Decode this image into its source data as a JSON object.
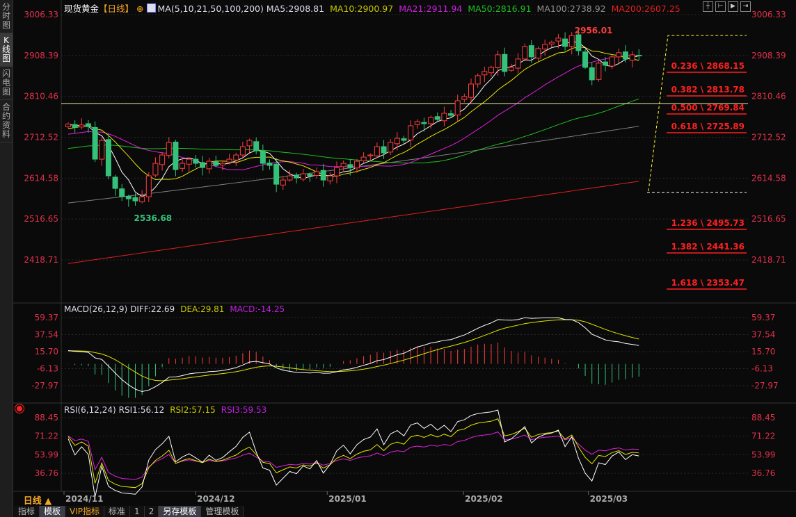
{
  "sidebar": {
    "tabs": [
      {
        "label": "分时图",
        "active": false
      },
      {
        "label": "K线图",
        "active": true
      },
      {
        "label": "闪电图",
        "active": false
      },
      {
        "label": "合约资料",
        "active": false
      }
    ]
  },
  "header": {
    "symbol": "现货黄金",
    "period": "【日线】",
    "ma_title": "MA(5,10,21,50,100,200)",
    "ma5": "MA5:2908.81",
    "ma10": "MA10:2900.97",
    "ma21": "MA21:2911.94",
    "ma50": "MA50:2816.91",
    "ma100": "MA100:2738.92",
    "ma200": "MA200:2607.25"
  },
  "toolbar_icons": [
    "crosshair-icon",
    "zoom-left-icon",
    "play-icon",
    "scroll-end-icon"
  ],
  "colors": {
    "up": "#ff3c3c",
    "down": "#34c27a",
    "ma5": "#ffffff",
    "ma10": "#e6e600",
    "ma21": "#e020e0",
    "ma50": "#20c020",
    "ma100": "#808080",
    "ma200": "#e02020",
    "axis": "#e0304a"
  },
  "price_axis": [
    "3006.33",
    "2908.39",
    "2810.46",
    "2712.52",
    "2614.58",
    "2516.65",
    "2418.71"
  ],
  "annotations": {
    "high": "2956.01",
    "low": "2536.68"
  },
  "fibonacci": [
    {
      "label": "0.236 \\ 2868.15"
    },
    {
      "label": "0.382 \\ 2813.78"
    },
    {
      "label": "0.500 \\ 2769.84"
    },
    {
      "label": "0.618 \\ 2725.89"
    },
    {
      "label": "1.236 \\ 2495.73"
    },
    {
      "label": "1.382 \\ 2441.36"
    },
    {
      "label": "1.618 \\ 2353.47"
    }
  ],
  "macd": {
    "title": "MACD(26,12,9)",
    "diff": "DIFF:22.69",
    "dea": "DEA:29.81",
    "macd": "MACD:-14.25",
    "axis": [
      "59.37",
      "37.54",
      "15.70",
      "-6.13",
      "-27.97"
    ]
  },
  "rsi": {
    "title": "RSI(6,12,24)",
    "rsi1": "RSI1:56.12",
    "rsi2": "RSI2:57.15",
    "rsi3": "RSI3:59.53",
    "axis": [
      "88.45",
      "71.22",
      "53.99",
      "36.76"
    ]
  },
  "x_axis": {
    "period_label": "日线 ▲",
    "dates": [
      {
        "label": "2024/11",
        "index": 0
      },
      {
        "label": "2024/12",
        "index": 19.6
      },
      {
        "label": "2025/01",
        "index": 39.2
      },
      {
        "label": "2025/02",
        "index": 59.5
      },
      {
        "label": "2025/03",
        "index": 78.1
      }
    ]
  },
  "bottom_tabs": [
    {
      "label": "指标",
      "selected": false
    },
    {
      "label": "模板",
      "selected": true
    },
    {
      "label": "VIP指标",
      "selected": false,
      "vip": true
    },
    {
      "label": "标准",
      "selected": false
    },
    {
      "label": "1",
      "selected": false
    },
    {
      "label": "2",
      "selected": false
    },
    {
      "label": "另存模板",
      "selected": true
    },
    {
      "label": "管理模板",
      "selected": false
    }
  ],
  "chart_data": {
    "type": "candlestick",
    "closes": [
      2744,
      2736,
      2742,
      2738,
      2660,
      2705,
      2620,
      2590,
      2570,
      2565,
      2560,
      2570,
      2620,
      2650,
      2670,
      2700,
      2635,
      2650,
      2660,
      2650,
      2640,
      2655,
      2645,
      2650,
      2660,
      2670,
      2690,
      2705,
      2680,
      2650,
      2645,
      2600,
      2610,
      2620,
      2615,
      2625,
      2620,
      2630,
      2610,
      2620,
      2640,
      2650,
      2640,
      2655,
      2665,
      2670,
      2690,
      2675,
      2700,
      2710,
      2705,
      2740,
      2750,
      2745,
      2760,
      2755,
      2770,
      2765,
      2800,
      2810,
      2840,
      2860,
      2870,
      2880,
      2910,
      2870,
      2880,
      2900,
      2930,
      2905,
      2925,
      2935,
      2940,
      2950,
      2930,
      2956,
      2920,
      2880,
      2850,
      2890,
      2885,
      2905,
      2915,
      2900,
      2910,
      2908
    ],
    "ma100_range": [
      2555,
      2739
    ],
    "ma200_range": [
      2410,
      2607
    ],
    "price_ylim": [
      2418.71,
      3006.33
    ],
    "macd_ylim": [
      -27.97,
      59.37
    ],
    "rsi_ylim": [
      36.76,
      88.45
    ],
    "horizontal_line_price": 2793.3
  }
}
